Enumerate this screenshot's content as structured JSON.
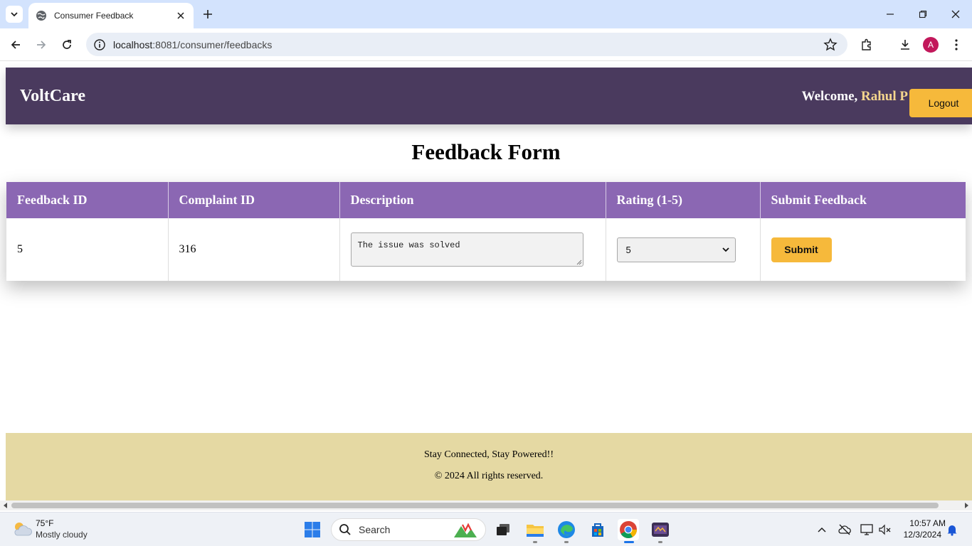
{
  "browser": {
    "tab_title": "Consumer Feedback",
    "url_host": "localhost",
    "url_path": ":8081/consumer/feedbacks",
    "profile_initial": "A"
  },
  "header": {
    "brand": "VoltCare",
    "welcome_prefix": "Welcome, ",
    "user_name": "Rahul P",
    "logout_label": "Logout"
  },
  "main": {
    "title": "Feedback Form",
    "table": {
      "columns": [
        "Feedback ID",
        "Complaint ID",
        "Description",
        "Rating (1-5)",
        "Submit Feedback"
      ],
      "rows": [
        {
          "feedback_id": "5",
          "complaint_id": "316",
          "description": "The issue was solved",
          "rating": "5",
          "submit_label": "Submit"
        }
      ]
    }
  },
  "footer": {
    "line1": "Stay Connected, Stay Powered!!",
    "line2": "© 2024 All rights reserved."
  },
  "taskbar": {
    "weather_temp": "75°F",
    "weather_desc": "Mostly cloudy",
    "search_label": "Search",
    "time": "10:57 AM",
    "date": "12/3/2024"
  },
  "colors": {
    "header_bg": "#4a3a5e",
    "table_header_bg": "#8b67b3",
    "accent_button": "#f6b93b",
    "footer_bg": "#e5d9a3",
    "username_color": "#f4d58d"
  }
}
